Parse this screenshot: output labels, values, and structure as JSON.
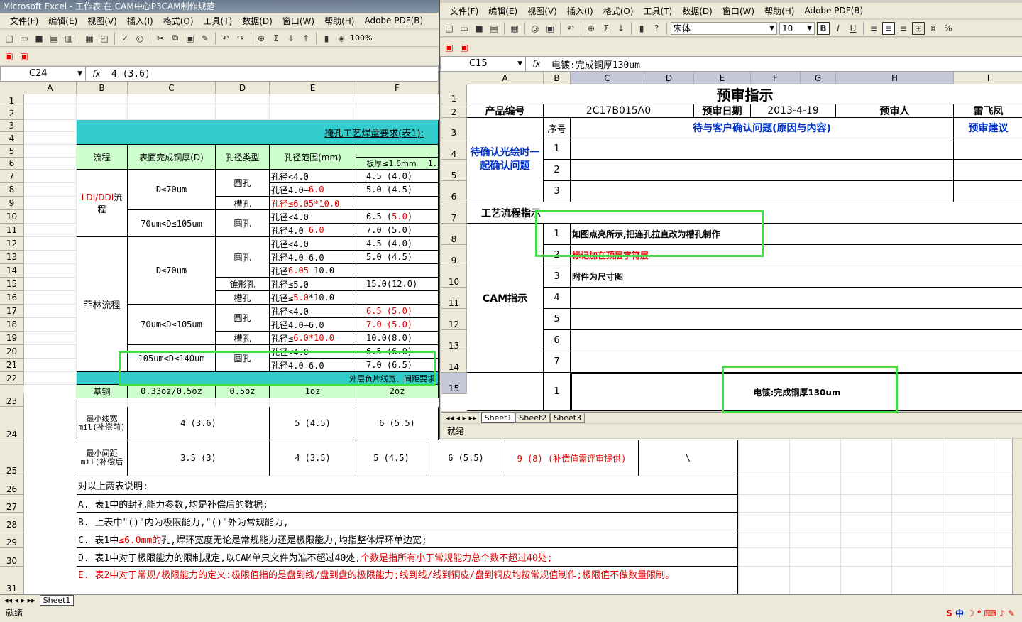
{
  "left": {
    "title": "Microsoft Excel - 工作表 在 CAM中心P3CAM制作规范",
    "menus": [
      "文件(F)",
      "编辑(E)",
      "视图(V)",
      "插入(I)",
      "格式(O)",
      "工具(T)",
      "数据(D)",
      "窗口(W)",
      "帮助(H)",
      "Adobe PDF(B)"
    ],
    "zoom": "100%",
    "namebox": "C24",
    "formula": "4 (3.6)",
    "cols": [
      "A",
      "B",
      "C",
      "D",
      "E",
      "F"
    ],
    "rows": [
      "1",
      "2",
      "3",
      "4",
      "5",
      "6",
      "7",
      "8",
      "9",
      "10",
      "11",
      "12",
      "13",
      "14",
      "15",
      "16",
      "17",
      "18",
      "19",
      "20",
      "21",
      "22",
      "23",
      "24",
      "25",
      "26",
      "27",
      "28",
      "29",
      "30",
      "31"
    ],
    "table_title": "掩孔工艺焊盘要求(表1):",
    "hdr_flow": "流程",
    "hdr_cu": "表面完成铜厚(D)",
    "hdr_hole": "孔径类型",
    "hdr_range": "孔径范围(mm)",
    "hdr_board": "板厚≤1.6mm",
    "hdr_board2": "1.",
    "flow_ldi_a": "LDI/DDI",
    "flow_ldi_b": "流",
    "flow_ldi_c": "程",
    "flow_fl": "菲林流程",
    "cu1": "D≤70um",
    "cu2": "70um<D≤105um",
    "cu3": "D≤70um",
    "cu4": "70um<D≤105um",
    "cu5": "105um<D≤140um",
    "round": "圆孔",
    "slot": "槽孔",
    "cone": "锥形孔",
    "r7": "孔径<4.0",
    "v7": "4.5 (4.0)",
    "r8a": "孔径4.0—",
    "r8b": "6.0",
    "v8": "5.0 (4.5)",
    "r9": "孔径≤6.05*10.0",
    "r10": "孔径<4.0",
    "v10a": "6.5 (",
    "v10b": "5.0",
    "v10c": ")",
    "r11a": "孔径4.0—",
    "r11b": "6.0",
    "v11": "7.0 (5.0)",
    "r12": "孔径<4.0",
    "v12": "4.5 (4.0)",
    "r13": "孔径4.0—6.0",
    "v13": "5.0 (4.5)",
    "r14a": "孔径",
    "r14b": "6.05",
    "r14c": "—10.0",
    "r15": "孔径≤5.0",
    "v15": "15.0(12.0)",
    "r16a": "孔径≤",
    "r16b": "5.0",
    "r16c": "*10.0",
    "r17": "孔径<4.0",
    "v17": "6.5 (5.0)",
    "r18": "孔径4.0—6.0",
    "v18": "7.0 (5.0)",
    "r19a": "孔径≤",
    "r19b": "6.0*10.0",
    "v19": "10.0(8.0)",
    "r20": "孔径<4.0",
    "v20": "6.5 (6.0)",
    "r21": "孔径4.0—6.0",
    "v21": "7.0 (6.5)",
    "r22": "外层负片线宽、间距要求",
    "h23a": "基铜",
    "h23b": "0.33oz/0.5oz",
    "h23c": "0.5oz",
    "h23d": "1oz",
    "h23e": "2oz",
    "l24": "最小线宽mil(补偿前)",
    "v24c": "4 (3.6)",
    "v24e": "5 (4.5)",
    "v24f": "6 (5.5)",
    "l25": "最小间距mil(补偿后",
    "v25c": "3.5 (3)",
    "v25e": "4 (3.5)",
    "v25f": "5 (4.5)",
    "v25g": "6 (5.5)",
    "v25h": "9 (8) (补偿值需评审提供)",
    "v25i": "\\",
    "n26": "对以上两表说明:",
    "n27": "A. 表1中的封孔能力参数,均是补偿后的数据;",
    "n28": "B. 上表中\"()\"内为极限能力,\"()\"外为常规能力,",
    "n29a": "C. 表1中",
    "n29b": "≤6.0mm的",
    "n29c": "孔,焊环宽度无论是常规能力还是极限能力,均指整体焊环单边宽;",
    "n30a": "D. 表1中对于极限能力的限制规定,以CAM单只文件为准不超过40处,",
    "n30b": "个数是指所有小于常规能力总个数不超过40处;",
    "n31": "E. 表2中对于常规/极限能力的定义:极限值指的是盘到线/盘到盘的极限能力;线到线/线到铜皮/盘到铜皮均按常规值制作;极限值不做数量限制。",
    "sheet": "Sheet1",
    "status": "就绪"
  },
  "right": {
    "menus": [
      "文件(F)",
      "编辑(E)",
      "视图(V)",
      "插入(I)",
      "格式(O)",
      "工具(T)",
      "数据(D)",
      "窗口(W)",
      "帮助(H)",
      "Adobe PDF(B)"
    ],
    "font": "宋体",
    "size": "10",
    "namebox": "C15",
    "formula": "电镀:完成铜厚130um",
    "cols": [
      "A",
      "B",
      "C",
      "D",
      "E",
      "F",
      "G",
      "H",
      "I"
    ],
    "rows": [
      "1",
      "2",
      "3",
      "4",
      "5",
      "6",
      "7",
      "8",
      "9",
      "10",
      "11",
      "12",
      "13",
      "14",
      "15"
    ],
    "title": "预审指示",
    "r2a": "产品编号",
    "r2b": "2C17B015A0",
    "r2c": "预审日期",
    "r2d": "2013-4-19",
    "r2e": "预审人",
    "r2f": "雷飞凤",
    "r3a": "序号",
    "r3b": "待与客户确认问题(原因与内容)",
    "r3c": "预审建议",
    "r4": "待确认光绘时一起确认问题",
    "n1": "1",
    "n2": "2",
    "n3": "3",
    "n4": "4",
    "n5": "5",
    "n6": "6",
    "n7": "7",
    "r7": "工艺流程指示",
    "r8": "如图点亮所示,把连孔拉直改为槽孔制作",
    "r9": "标记加在顶层字符层",
    "r10": "附件为尺寸图",
    "cam": "CAM指示",
    "r15": "电镀:完成铜厚130um",
    "sheets": [
      "Sheet1",
      "Sheet2",
      "Sheet3"
    ],
    "status": "就绪"
  },
  "tray": "中"
}
